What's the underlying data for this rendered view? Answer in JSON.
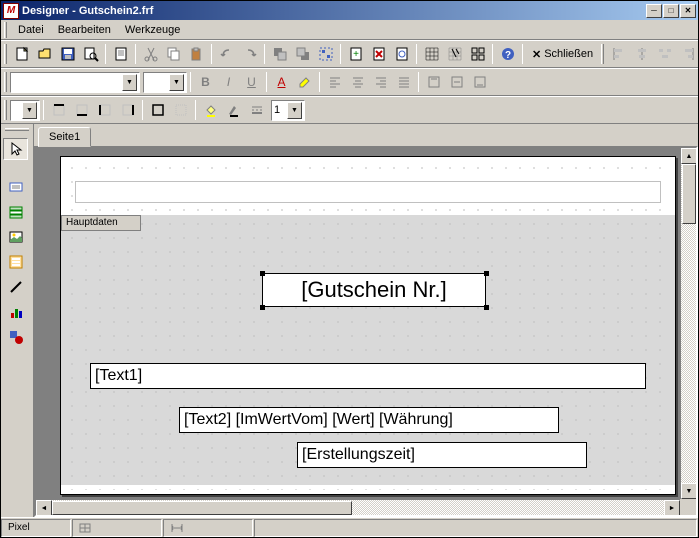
{
  "window": {
    "title": "Designer - Gutschein2.frf",
    "icon_letter": "M"
  },
  "menu": {
    "file": "Datei",
    "edit": "Bearbeiten",
    "tools": "Werkzeuge"
  },
  "toolbar1": {
    "close_label": "Schließen"
  },
  "toolbar2": {
    "font_name": "",
    "font_size": ""
  },
  "toolbar3": {
    "heading": "",
    "number": "1"
  },
  "tabs": {
    "page1": "Seite1"
  },
  "bands": {
    "hauptdaten": "Hauptdaten"
  },
  "fields": {
    "gutschein_nr": "[Gutschein Nr.]",
    "text1": "[Text1]",
    "line2": "[Text2] [ImWertVom] [Wert] [Währung]",
    "erstellungszeit": "[Erstellungszeit]"
  },
  "status": {
    "pixel": "Pixel"
  }
}
